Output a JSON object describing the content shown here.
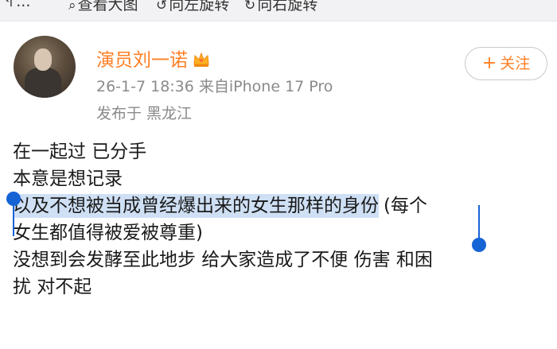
{
  "toolbar": {
    "items": [
      {
        "icon": "back-icon",
        "label": "..."
      },
      {
        "icon": "image-search-icon",
        "label": "查看大图"
      },
      {
        "icon": "rotate-left-icon",
        "label": "向左旋转"
      },
      {
        "icon": "rotate-right-icon",
        "label": "向右旋转"
      }
    ]
  },
  "post": {
    "username": "演员刘一诺",
    "badge": "crown-icon",
    "meta": "26-1-7 18:36  来自iPhone 17 Pro",
    "location": "发布于 黑龙江",
    "follow_label": "关注",
    "lines": [
      "在一起过 已分手",
      "本意是想记录",
      "以及不想被当成曾经爆出来的女生那样的身份",
      "(每个",
      "女生都值得被爱被尊重)",
      "没想到会发酵至此地步 给大家造成了不便 伤害 和困",
      "扰 对不起"
    ]
  },
  "colors": {
    "accent": "#ff7f24",
    "selection": "#1663d6",
    "highlight": "#cfe0f5",
    "meta_text": "#8a8a8a"
  }
}
